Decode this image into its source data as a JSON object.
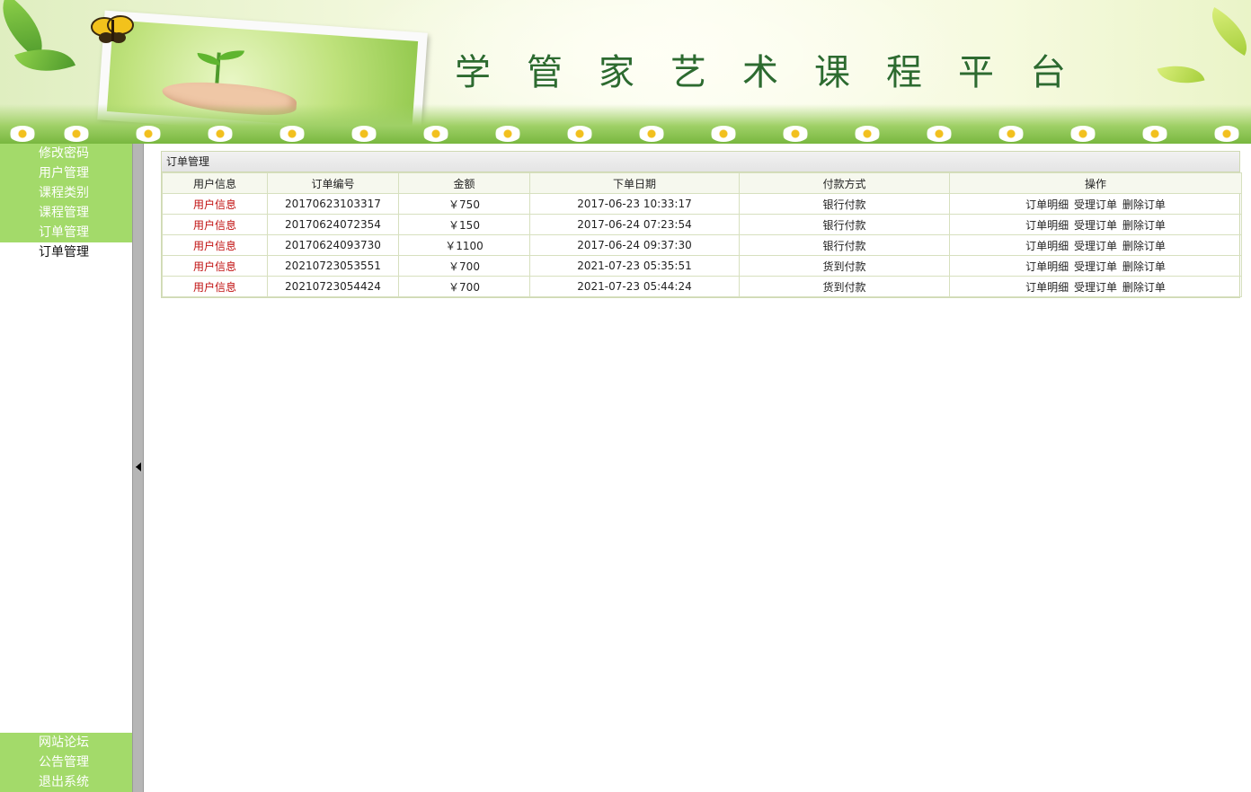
{
  "banner": {
    "title": "学管家艺术课程平台"
  },
  "sidebar": {
    "top_items": [
      {
        "label": "修改密码"
      },
      {
        "label": "用户管理"
      },
      {
        "label": "课程类别"
      },
      {
        "label": "课程管理"
      },
      {
        "label": "订单管理"
      }
    ],
    "sub_items": [
      {
        "label": "订单管理"
      }
    ],
    "bottom_items": [
      {
        "label": "网站论坛"
      },
      {
        "label": "公告管理"
      },
      {
        "label": "退出系统"
      }
    ]
  },
  "splitter": {
    "icon": "collapse-left-arrow-icon"
  },
  "orders_panel": {
    "title": "订单管理",
    "columns": [
      "用户信息",
      "订单编号",
      "金额",
      "下单日期",
      "付款方式",
      "操作"
    ],
    "rows": [
      {
        "user_link": "用户信息",
        "order_no": "20170623103317",
        "amount": "￥750",
        "date": "2017-06-23 10:33:17",
        "payment": "银行付款",
        "actions": [
          "订单明细",
          "受理订单",
          "删除订单"
        ]
      },
      {
        "user_link": "用户信息",
        "order_no": "20170624072354",
        "amount": "￥150",
        "date": "2017-06-24 07:23:54",
        "payment": "银行付款",
        "actions": [
          "订单明细",
          "受理订单",
          "删除订单"
        ]
      },
      {
        "user_link": "用户信息",
        "order_no": "20170624093730",
        "amount": "￥1100",
        "date": "2017-06-24 09:37:30",
        "payment": "银行付款",
        "actions": [
          "订单明细",
          "受理订单",
          "删除订单"
        ]
      },
      {
        "user_link": "用户信息",
        "order_no": "20210723053551",
        "amount": "￥700",
        "date": "2021-07-23 05:35:51",
        "payment": "货到付款",
        "actions": [
          "订单明细",
          "受理订单",
          "删除订单"
        ]
      },
      {
        "user_link": "用户信息",
        "order_no": "20210723054424",
        "amount": "￥700",
        "date": "2021-07-23 05:44:24",
        "payment": "货到付款",
        "actions": [
          "订单明细",
          "受理订单",
          "删除订单"
        ]
      }
    ]
  },
  "colors": {
    "menu_green": "#a3da6a",
    "title_green": "#2d6b2f",
    "user_link_red": "#c01010"
  }
}
